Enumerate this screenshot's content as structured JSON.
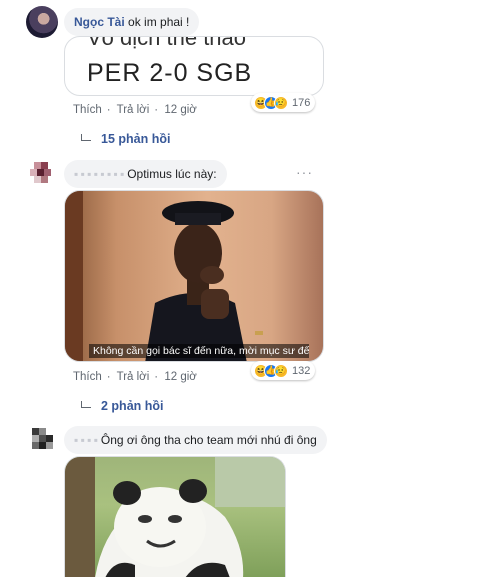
{
  "comments": [
    {
      "author": "Ngọc Tài",
      "text": "ok im phai !",
      "image_text": "PER 2-0 SGB",
      "image_text_top": "Vô địch thể thao",
      "actions": {
        "like": "Thích",
        "reply": "Trả lời",
        "time": "12 giờ"
      },
      "reaction_count": "176",
      "replies": "15 phản hồi"
    },
    {
      "author": "▪ ▪ ▪ ▪ ▪ ▪ ▪ ▪",
      "text": "Optimus lúc này:",
      "image_caption": "Không cần gọi bác sĩ đến nữa, mời mục sư đến đi",
      "actions": {
        "like": "Thích",
        "reply": "Trả lời",
        "time": "12 giờ"
      },
      "reaction_count": "132",
      "replies": "2 phản hồi",
      "more": "···"
    },
    {
      "author": "▪ ▪ ▪ ▪",
      "text": "Ông ơi ông tha cho team mới nhú đi ông"
    }
  ],
  "reaction_icons": [
    "haha-icon",
    "like-icon",
    "sad-icon"
  ],
  "colors": {
    "link": "#385898",
    "bubble": "#f2f3f5",
    "meta": "#606770"
  }
}
